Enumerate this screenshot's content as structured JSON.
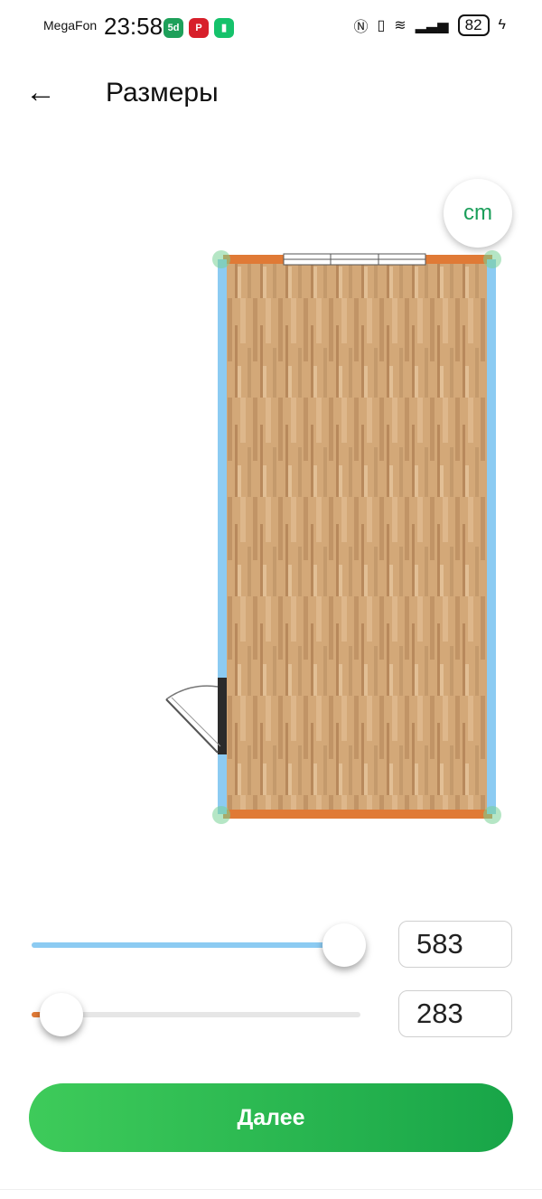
{
  "status_bar": {
    "carrier": "MegaFon",
    "time": "23:58",
    "battery": "82",
    "icons": [
      "5d-app-icon",
      "pinterest-icon",
      "green-app-icon",
      "nfc-icon",
      "vibrate-icon",
      "wifi-icon",
      "signal-icon",
      "charging-icon"
    ]
  },
  "header": {
    "back_icon": "arrow-left-icon",
    "title": "Размеры"
  },
  "unit_button": {
    "label": "cm"
  },
  "room": {
    "floor": "wood parquet",
    "colors": {
      "wall_long": "#8ccbf2",
      "wall_short": "#e07a36",
      "floor": "#cfa273",
      "door": "#2b2b2b"
    }
  },
  "sliders": [
    {
      "value": "583",
      "fill_fraction": 0.95,
      "color": "#8ccbf2"
    },
    {
      "value": "283",
      "fill_fraction": 0.09,
      "color": "#e07a36"
    }
  ],
  "next_button": {
    "label": "Далее"
  }
}
